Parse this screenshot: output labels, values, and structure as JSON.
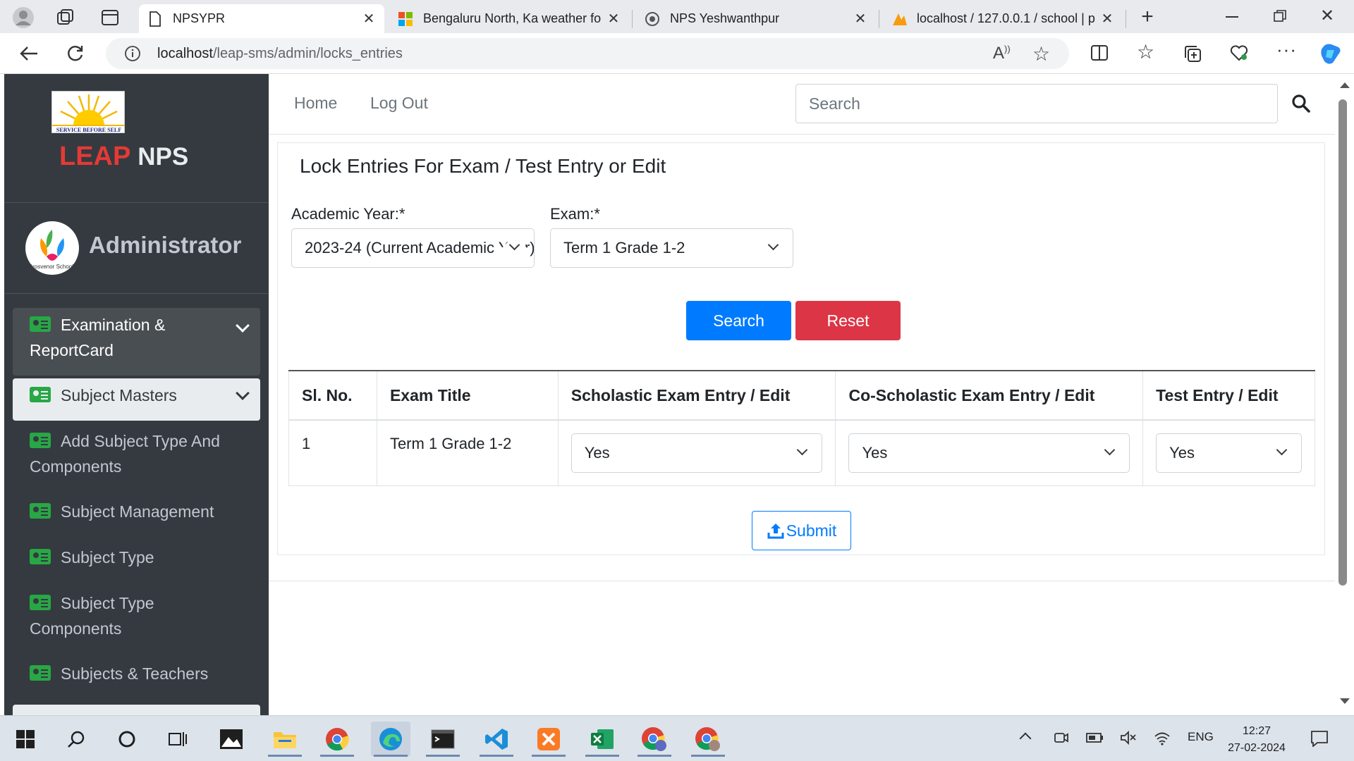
{
  "browser": {
    "tabs": [
      {
        "title": "NPSYPR",
        "active": true
      },
      {
        "title": "Bengaluru North, Ka weather fo",
        "active": false
      },
      {
        "title": "NPS Yeshwanthpur",
        "active": false
      },
      {
        "title": "localhost / 127.0.0.1 / school | p",
        "active": false
      }
    ],
    "url_host": "localhost",
    "url_path": "/leap-sms/admin/locks_entries"
  },
  "sidebar": {
    "logo_tagline": "SERVICE BEFORE SELF",
    "brand_leap": "LEAP",
    "brand_nps": "NPS",
    "user_name": "Administrator",
    "avatar_caption": "Grosvenor School",
    "items": [
      {
        "label": "Examination & ReportCard",
        "state": "open"
      },
      {
        "label": "Subject Masters",
        "state": "active"
      },
      {
        "label": "Add Subject Type And Components",
        "state": "normal"
      },
      {
        "label": "Subject Management",
        "state": "normal"
      },
      {
        "label": "Subject Type",
        "state": "normal"
      },
      {
        "label": "Subject Type Components",
        "state": "normal"
      },
      {
        "label": "Subjects & Teachers",
        "state": "normal"
      }
    ]
  },
  "topnav": {
    "home": "Home",
    "logout": "Log Out",
    "search_placeholder": "Search"
  },
  "form": {
    "title": "Lock Entries For Exam / Test Entry or Edit",
    "academic_year_label": "Academic Year:*",
    "academic_year_value": "2023-24 (Current Academic Year)",
    "exam_label": "Exam:*",
    "exam_value": "Term 1 Grade 1-2",
    "search_button": "Search",
    "reset_button": "Reset",
    "submit_button": "Submit"
  },
  "table": {
    "headers": [
      "Sl. No.",
      "Exam Title",
      "Scholastic Exam Entry / Edit",
      "Co-Scholastic Exam Entry / Edit",
      "Test Entry / Edit"
    ],
    "rows": [
      {
        "sl": "1",
        "title": "Term 1 Grade 1-2",
        "scholastic": "Yes",
        "co_scholastic": "Yes",
        "test": "Yes"
      }
    ]
  },
  "taskbar": {
    "language": "ENG",
    "time": "12:27",
    "date": "27-02-2024"
  },
  "colors": {
    "primary": "#007bff",
    "danger": "#dc3545",
    "sidebar_bg": "#343a40",
    "icon_green": "#28a745"
  }
}
